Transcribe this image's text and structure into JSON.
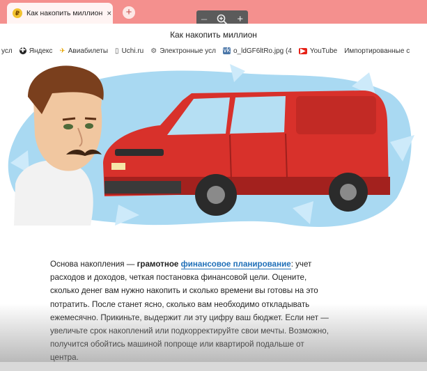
{
  "tab": {
    "title": "Как накопить миллион",
    "close_glyph": "×",
    "favicon_letter": "₽"
  },
  "newtab_glyph": "+",
  "zoom": {
    "minus": "–",
    "plus": "+"
  },
  "window_title": "Как накопить миллион",
  "bookmarks": [
    {
      "label": "усл",
      "icon": "none"
    },
    {
      "label": "Яндекс",
      "icon": "yandex-icon"
    },
    {
      "label": "Авиабилеты",
      "icon": "plane-icon"
    },
    {
      "label": "Uchi.ru",
      "icon": "document-icon"
    },
    {
      "label": "Электронные усл",
      "icon": "gosuslugi-icon"
    },
    {
      "label": "o_ldGF6ltRo.jpg (4",
      "icon": "vk-icon"
    },
    {
      "label": "YouTube",
      "icon": "youtube-icon"
    },
    {
      "label": "Импортированные с",
      "icon": "folder-icon"
    }
  ],
  "article": {
    "part1": "Основа накопления — ",
    "bold": "грамотное",
    "space": " ",
    "link": "финансовое планирование",
    "part2": ": учет расходов и доходов, четкая постановка финансовой цели. Оцените, сколько денег вам нужно накопить и сколько времени вы готовы на это потратить. После станет ясно, сколько вам необходимо откладывать ежемесячно. Прикиньте, выдержит ли эту цифру ваш бюджет. Если нет — увеличьте срок накоплений или подкорректируйте свои мечты. Возможно, получится обойтись машиной попроще или квартирой подальше от центра."
  },
  "colors": {
    "tab_strip": "#f4908e",
    "van": "#d8312b",
    "splash": "#a9d9f2",
    "link": "#1f6fb8"
  }
}
